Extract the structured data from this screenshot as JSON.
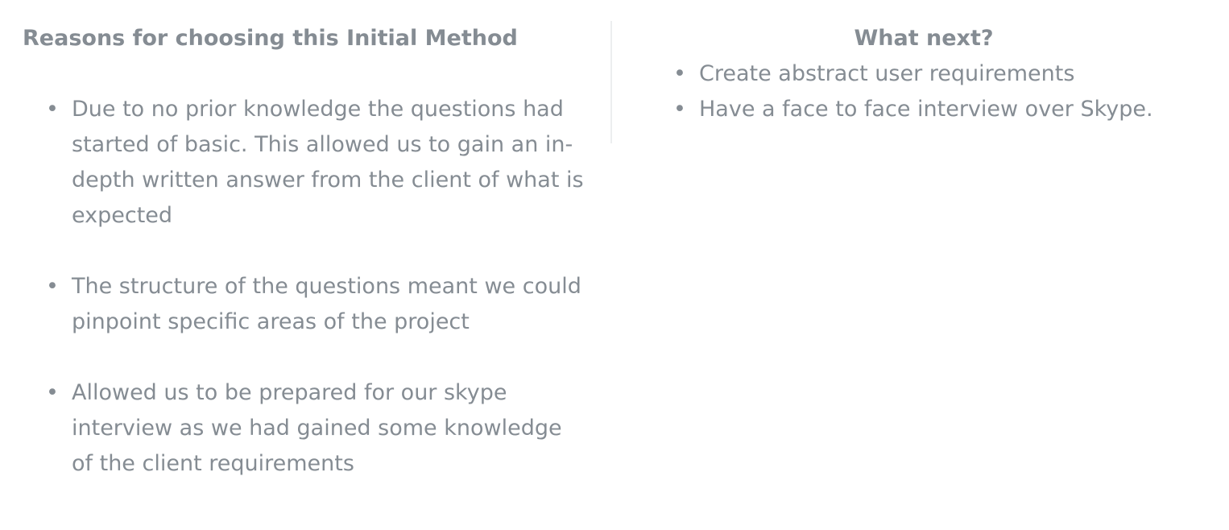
{
  "left": {
    "heading": "Reasons for choosing this Initial Method",
    "items": [
      {
        "text": "Due to no prior knowledge the questions had started of basic. This allowed us to gain an in-depth written answer from the client of what is expected"
      },
      {
        "text": "The structure of the questions meant we could pinpoint specific areas of the project"
      },
      {
        "text": "Allowed us to be prepared for our skype interview as we had gained some knowledge of the client requirements"
      }
    ]
  },
  "right": {
    "heading": "What next?",
    "items": [
      {
        "text": "Create abstract user requirements"
      },
      {
        "text": "Have a face to face interview over Skype."
      }
    ]
  },
  "bullet_glyph": "•",
  "colors": {
    "text": "#858c93",
    "divider": "#eceeef",
    "background": "#ffffff"
  }
}
